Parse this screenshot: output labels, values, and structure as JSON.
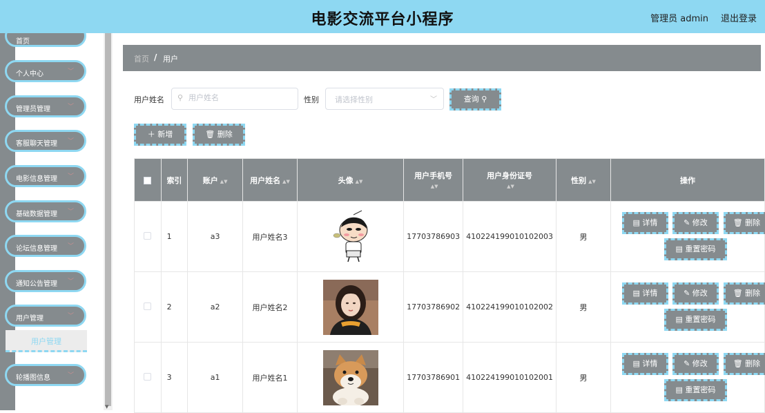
{
  "header": {
    "title": "电影交流平台小程序",
    "admin": "管理员 admin",
    "logout": "退出登录"
  },
  "sidebar": {
    "items": [
      {
        "label": "首页"
      },
      {
        "label": "个人中心"
      },
      {
        "label": "管理员管理"
      },
      {
        "label": "客服聊天管理"
      },
      {
        "label": "电影信息管理"
      },
      {
        "label": "基础数据管理"
      },
      {
        "label": "论坛信息管理"
      },
      {
        "label": "通知公告管理"
      },
      {
        "label": "用户管理"
      },
      {
        "label": "轮播图信息"
      }
    ],
    "submenu": {
      "label": "用户管理"
    }
  },
  "breadcrumb": {
    "home": "首页",
    "separator": "/",
    "current": "用户"
  },
  "search": {
    "name_label": "用户姓名",
    "name_placeholder": "用户姓名",
    "gender_label": "性别",
    "gender_placeholder": "请选择性别",
    "search_button": "查询"
  },
  "actions": {
    "add": "新增",
    "delete": "删除"
  },
  "table": {
    "headers": {
      "index": "索引",
      "account": "账户",
      "name": "用户姓名",
      "avatar": "头像",
      "phone": "用户手机号",
      "idcard": "用户身份证号",
      "gender": "性别",
      "ops": "操作"
    },
    "rows": [
      {
        "index": "1",
        "account": "a3",
        "name": "用户姓名3",
        "phone": "17703786903",
        "idcard": "410224199010102003",
        "gender": "男"
      },
      {
        "index": "2",
        "account": "a2",
        "name": "用户姓名2",
        "phone": "17703786902",
        "idcard": "410224199010102002",
        "gender": "男"
      },
      {
        "index": "3",
        "account": "a1",
        "name": "用户姓名1",
        "phone": "17703786901",
        "idcard": "410224199010102001",
        "gender": "男"
      }
    ],
    "row_buttons": {
      "detail": "详情",
      "edit": "修改",
      "delete": "删除",
      "reset": "重置密码"
    }
  },
  "colors": {
    "header_bg": "#8ed8f2",
    "accent": "#8ed8f2",
    "button_bg": "#858b8e"
  }
}
